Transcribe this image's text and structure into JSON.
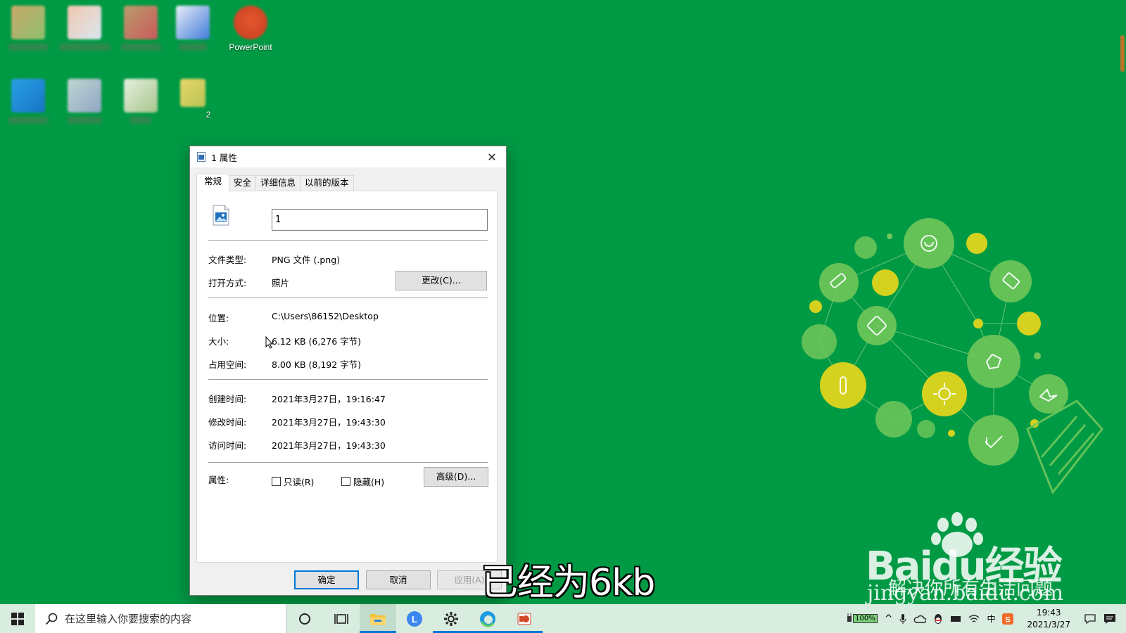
{
  "desktop": {
    "icons": [
      {
        "label": "",
        "colors": [
          "#c9a86a",
          "#8fbf6f"
        ]
      },
      {
        "label": "",
        "colors": [
          "#f2c6b0",
          "#d8e8f0"
        ]
      },
      {
        "label": "",
        "colors": [
          "#b99c6c",
          "#c95a5a"
        ]
      },
      {
        "label": "",
        "colors": [
          "#e9eef7",
          "#3f7bd8"
        ]
      },
      {
        "label": "PowerPoint",
        "colors": [
          "#e4572e",
          "#c43d1f"
        ]
      },
      {
        "label": "",
        "colors": [
          "#2aa0e6",
          "#1774c6"
        ]
      },
      {
        "label": "",
        "colors": [
          "#c0d6d2",
          "#8fa6c4"
        ]
      },
      {
        "label": "",
        "colors": [
          "#e6f0e0",
          "#a7c48d"
        ]
      },
      {
        "label": "2",
        "colors": [
          "#e8d66a",
          "#b9c455"
        ]
      }
    ]
  },
  "dialog": {
    "title": "1 属性",
    "close_glyph": "✕",
    "tabs": [
      "常规",
      "安全",
      "详细信息",
      "以前的版本"
    ],
    "name_value": "1",
    "file_type_label": "文件类型:",
    "file_type_value": "PNG 文件 (.png)",
    "open_with_label": "打开方式:",
    "open_with_value": "照片",
    "change_button": "更改(C)...",
    "location_label": "位置:",
    "location_value": "C:\\Users\\86152\\Desktop",
    "size_label": "大小:",
    "size_value": "6.12 KB (6,276 字节)",
    "size_on_disk_label": "占用空间:",
    "size_on_disk_value": "8.00 KB (8,192 字节)",
    "created_label": "创建时间:",
    "created_value": "2021年3月27日，19:16:47",
    "modified_label": "修改时间:",
    "modified_value": "2021年3月27日，19:43:30",
    "accessed_label": "访问时间:",
    "accessed_value": "2021年3月27日，19:43:30",
    "attributes_label": "属性:",
    "readonly_label": "只读(R)",
    "hidden_label": "隐藏(H)",
    "advanced_button": "高级(D)...",
    "ok_button": "确定",
    "cancel_button": "取消",
    "apply_button": "应用(A)"
  },
  "overlay": {
    "subtitle": "已经为6kb",
    "watermark_brand": "Baidu经验",
    "watermark_tagline": "解决你所有生活问题",
    "watermark_site": "jingyan.baidu.com"
  },
  "taskbar": {
    "search_placeholder": "在这里输入你要搜索的内容",
    "battery_percent": "100%",
    "ime_label": "中",
    "time": "19:43",
    "date": "2021/3/27"
  },
  "colors": {
    "desktop_bg": "#009a44",
    "accent": "#0078d7",
    "taskbar_bg": "#d9ece0"
  }
}
